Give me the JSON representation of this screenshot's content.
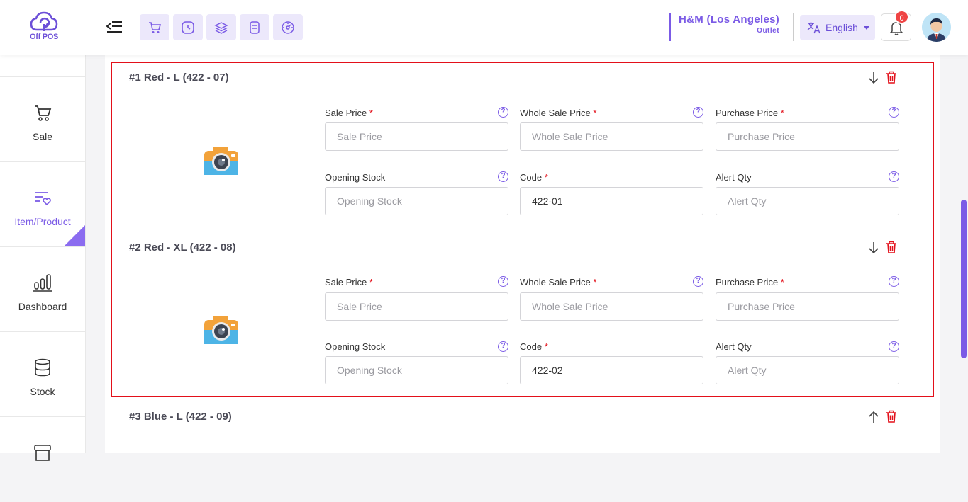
{
  "header": {
    "logo_text": "Off POS",
    "outlet_name": "H&M (Los Angeles)",
    "outlet_sub": "Outlet",
    "language": "English",
    "notification_count": "0",
    "quick_icons": [
      "cart-icon",
      "clock-icon",
      "layers-icon",
      "receipt-icon",
      "gauge-icon"
    ]
  },
  "sidebar": {
    "items": [
      {
        "label": "Sale",
        "icon": "cart-icon"
      },
      {
        "label": "Item/Product",
        "icon": "list-heart-icon",
        "active": true
      },
      {
        "label": "Dashboard",
        "icon": "bar-chart-icon"
      },
      {
        "label": "Stock",
        "icon": "database-icon"
      }
    ]
  },
  "labels": {
    "sale_price": "Sale Price",
    "whole_sale_price": "Whole Sale Price",
    "purchase_price": "Purchase Price",
    "opening_stock": "Opening Stock",
    "code": "Code",
    "alert_qty": "Alert Qty",
    "required_mark": "*",
    "help": "?"
  },
  "placeholders": {
    "sale_price": "Sale Price",
    "whole_sale_price": "Whole Sale Price",
    "purchase_price": "Purchase Price",
    "opening_stock": "Opening Stock",
    "alert_qty": "Alert Qty"
  },
  "variants": [
    {
      "title": "#1 Red - L (422 - 07)",
      "code": "422-01"
    },
    {
      "title": "#2 Red - XL (422 - 08)",
      "code": "422-02"
    },
    {
      "title": "#3 Blue - L (422 - 09)",
      "code": ""
    }
  ],
  "colors": {
    "accent": "#7b5be6",
    "accent_light": "#ece8fb",
    "danger": "#e3101a"
  }
}
